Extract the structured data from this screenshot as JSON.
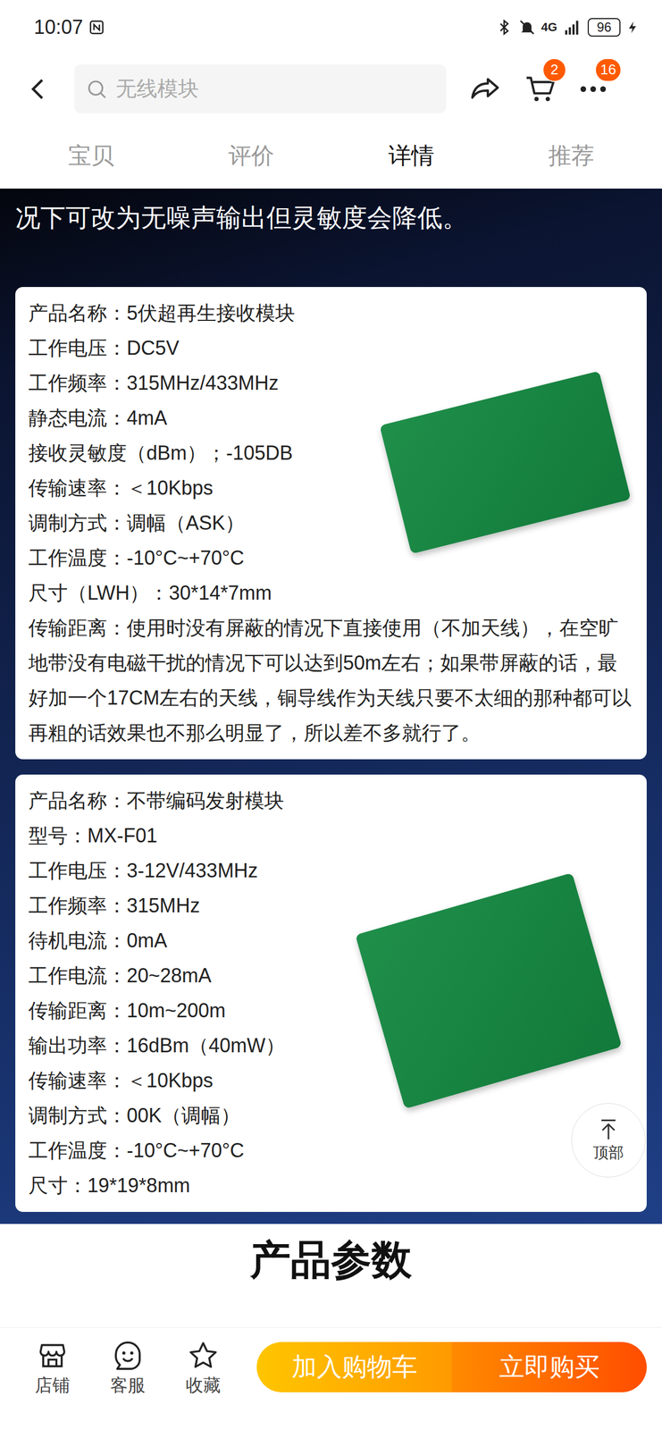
{
  "status_bar": {
    "time": "10:07",
    "network": "4G",
    "battery": "96"
  },
  "header": {
    "search_placeholder": "无线模块",
    "cart_badge": "2",
    "more_badge": "16"
  },
  "tabs": [
    {
      "label": "宝贝",
      "selected": false
    },
    {
      "label": "评价",
      "selected": false
    },
    {
      "label": "详情",
      "selected": true
    },
    {
      "label": "推荐",
      "selected": false
    }
  ],
  "detail": {
    "intro": "况下可改为无噪声输出但灵敏度会降低。",
    "cards": [
      {
        "lines": [
          "产品名称：5伏超再生接收模块",
          "工作电压：DC5V",
          "工作频率：315MHz/433MHz",
          "静态电流：4mA",
          "接收灵敏度（dBm）；-105DB",
          "传输速率：＜10Kbps",
          "调制方式：调幅（ASK）",
          "工作温度：-10°C~+70°C",
          "尺寸（LWH）：30*14*7mm"
        ],
        "paragraph": "传输距离：使用时没有屏蔽的情况下直接使用（不加天线），在空旷地带没有电磁干扰的情况下可以达到50m左右；如果带屏蔽的话，最好加一个17CM左右的天线，铜导线作为天线只要不太细的那种都可以再粗的话效果也不那么明显了，所以差不多就行了。"
      },
      {
        "lines": [
          "产品名称：不带编码发射模块",
          "型号：MX-F01",
          "工作电压：3-12V/433MHz",
          "工作频率：315MHz",
          "待机电流：0mA",
          "工作电流：20~28mA",
          "传输距离：10m~200m",
          "输出功率：16dBm（40mW）",
          "传输速率：＜10Kbps",
          "调制方式：00K（调幅）",
          "工作温度：-10°C~+70°C",
          "尺寸：19*19*8mm"
        ],
        "paragraph": ""
      }
    ]
  },
  "section_heading": "产品参数",
  "floating_button": {
    "label": "顶部"
  },
  "bottom_bar": {
    "shop": "店铺",
    "service": "客服",
    "favorite": "收藏",
    "add_to_cart": "加入购物车",
    "buy_now": "立即购买"
  }
}
